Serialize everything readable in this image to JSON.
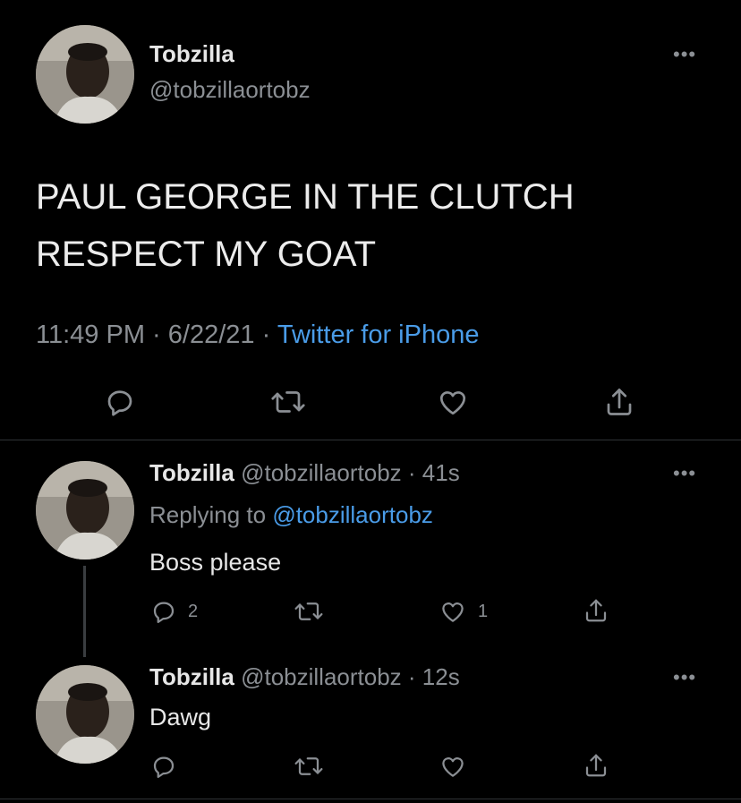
{
  "main_tweet": {
    "display_name": "Tobzilla",
    "handle": "@tobzillaortobz",
    "more": "•••",
    "text_line1": "PAUL GEORGE IN THE CLUTCH",
    "text_line2": "RESPECT MY GOAT",
    "time": "11:49 PM",
    "date": "6/22/21",
    "separator": "·",
    "source": "Twitter for iPhone"
  },
  "replies": [
    {
      "display_name": "Tobzilla",
      "handle": "@tobzillaortobz",
      "age": "41s",
      "replying_prefix": "Replying to",
      "replying_to": "@tobzillaortobz",
      "text": "Boss please",
      "reply_count": "2",
      "like_count": "1",
      "more": "•••"
    },
    {
      "display_name": "Tobzilla",
      "handle": "@tobzillaortobz",
      "age": "12s",
      "text": "Dawg",
      "more": "•••"
    }
  ],
  "icons": {
    "reply": "reply-icon",
    "retweet": "retweet-icon",
    "like": "like-icon",
    "share": "share-icon",
    "more": "more-icon"
  },
  "colors": {
    "background": "#000000",
    "text": "#e7e7e7",
    "muted": "#8b8f94",
    "link": "#4a9ce8",
    "divider": "#2f3336"
  }
}
